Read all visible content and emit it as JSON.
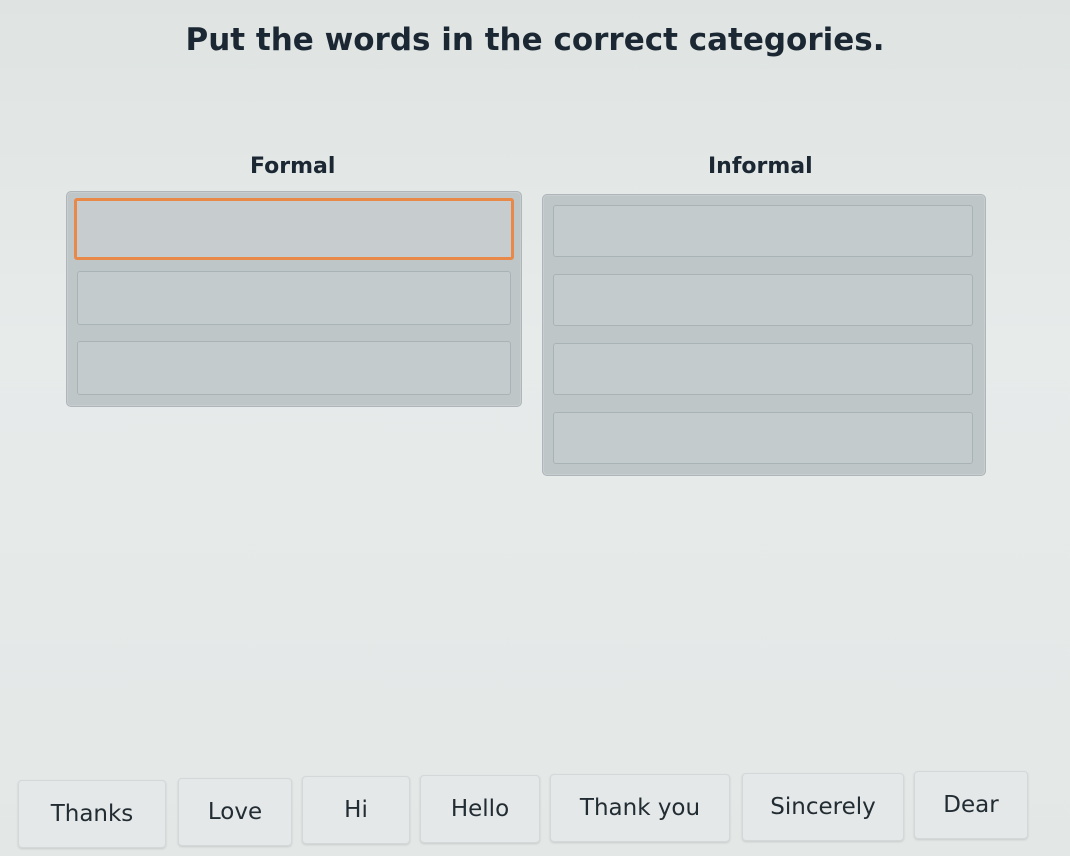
{
  "instruction": "Put the words in the correct categories.",
  "categories": [
    {
      "title": "Formal"
    },
    {
      "title": "Informal"
    }
  ],
  "words": [
    "Thanks",
    "Love",
    "Hi",
    "Hello",
    "Thank you",
    "Sincerely",
    "Dear"
  ],
  "colors": {
    "active_slot_border": "#e8894a",
    "zone_bg": "#bfc6c8"
  }
}
